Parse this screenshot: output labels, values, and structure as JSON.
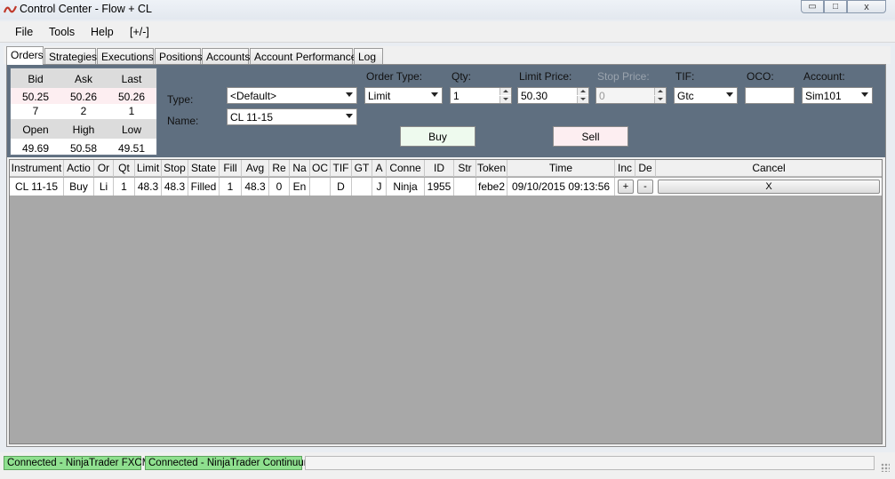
{
  "window": {
    "title": "Control Center - Flow + CL",
    "minimize_glyph": "▭",
    "maximize_glyph": "□",
    "close_glyph": "x"
  },
  "menu": {
    "items": [
      "File",
      "Tools",
      "Help",
      "[+/-]"
    ]
  },
  "tabs": [
    "Orders",
    "Strategies",
    "Executions",
    "Positions",
    "Accounts",
    "Account Performance",
    "Log"
  ],
  "quote": {
    "headers_top": [
      "Bid",
      "Ask",
      "Last"
    ],
    "prices": [
      "50.25",
      "50.26",
      "50.26"
    ],
    "sizes": [
      "7",
      "2",
      "1"
    ],
    "headers_bottom": [
      "Open",
      "High",
      "Low"
    ],
    "stats": [
      "49.69",
      "50.58",
      "49.51"
    ]
  },
  "order_entry": {
    "type_label": "Type:",
    "type_value": "<Default>",
    "name_label": "Name:",
    "name_value": "CL 11-15",
    "order_type_label": "Order Type:",
    "order_type_value": "Limit",
    "qty_label": "Qty:",
    "qty_value": "1",
    "limit_price_label": "Limit Price:",
    "limit_price_value": "50.30",
    "stop_price_label": "Stop Price:",
    "stop_price_value": "0",
    "tif_label": "TIF:",
    "tif_value": "Gtc",
    "oco_label": "OCO:",
    "oco_value": "",
    "account_label": "Account:",
    "account_value": "Sim101",
    "buy_label": "Buy",
    "sell_label": "Sell"
  },
  "orders_grid": {
    "columns": [
      "Instrument",
      "Actio",
      "Or",
      "Qt",
      "Limit",
      "Stop",
      "State",
      "Fill",
      "Avg",
      "Re",
      "Na",
      "OC",
      "TIF",
      "GT",
      "A",
      "Conne",
      "ID",
      "Str",
      "Token",
      "Time",
      "Inc",
      "De",
      "Cancel"
    ],
    "rows": [
      {
        "instrument": "CL 11-15",
        "action": "Buy",
        "order_type": "Li",
        "qty": "1",
        "limit": "48.3",
        "stop": "48.3",
        "state": "Filled",
        "filled": "1",
        "avg": "48.3",
        "remaining": "0",
        "name": "En",
        "oco": "",
        "tif": "D",
        "gtd": "",
        "account": "J",
        "connection": "Ninja",
        "id": "1955",
        "strategy": "",
        "token": "febe2",
        "time": "09/10/2015 09:13:56",
        "increase": "+",
        "decrease": "-",
        "cancel": "X"
      }
    ]
  },
  "status": {
    "connection_1": "Connected - NinjaTrader FXCM",
    "connection_2": "Connected - NinjaTrader Continuum"
  },
  "colors": {
    "panel_background": "#5f6f80",
    "buy_button": "#eefaee",
    "sell_button": "#fdeef1",
    "connected_status": "#8fe08f",
    "grid_empty": "#a8a8a8"
  }
}
